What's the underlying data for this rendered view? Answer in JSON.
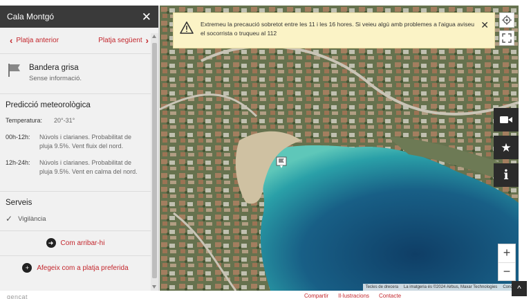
{
  "panel": {
    "title": "Cala Montgó",
    "close_icon": "close-icon",
    "prev_label": "Platja anterior",
    "next_label": "Platja següent",
    "flag": {
      "icon": "flag-icon",
      "title": "Bandera grisa",
      "subtitle": "Sense informació."
    },
    "forecast": {
      "title": "Predicció meteorològica",
      "temperature_label": "Temperatura:",
      "temperature_value": "20°-31°",
      "rows": [
        {
          "label": "00h-12h:",
          "text": "Núvols i clarianes. Probabilitat de pluja 9.5%. Vent fluix del nord."
        },
        {
          "label": "12h-24h:",
          "text": "Núvols i clarianes. Probabilitat de pluja 9.5%. Vent en calma del nord."
        }
      ]
    },
    "services": {
      "title": "Serveis",
      "items": [
        "Vigilància"
      ]
    },
    "directions_label": "Com arribar-hi",
    "favorite_label": "Afegeix com a platja preferida"
  },
  "alert": {
    "icon": "warning-icon",
    "text": "Extremeu la precaució sobretot entre les 11 i les 16 hores. Si veieu algú amb problemes a l'aigua aviseu el socorrista o truqueu al 112"
  },
  "map": {
    "attribution": [
      "Tecles de drecera",
      "La imatgeria és ©2024 Airbus, Maxar Technologies",
      "Condic"
    ]
  },
  "footer": {
    "brand": "gencat",
    "links": [
      "Compartir",
      "Il·lustracions",
      "Contacte"
    ]
  },
  "colors": {
    "accent": "#c3262c",
    "header": "#3a3a3a",
    "alert_bg": "#fbf3c6",
    "sea": "#1f5f85"
  }
}
